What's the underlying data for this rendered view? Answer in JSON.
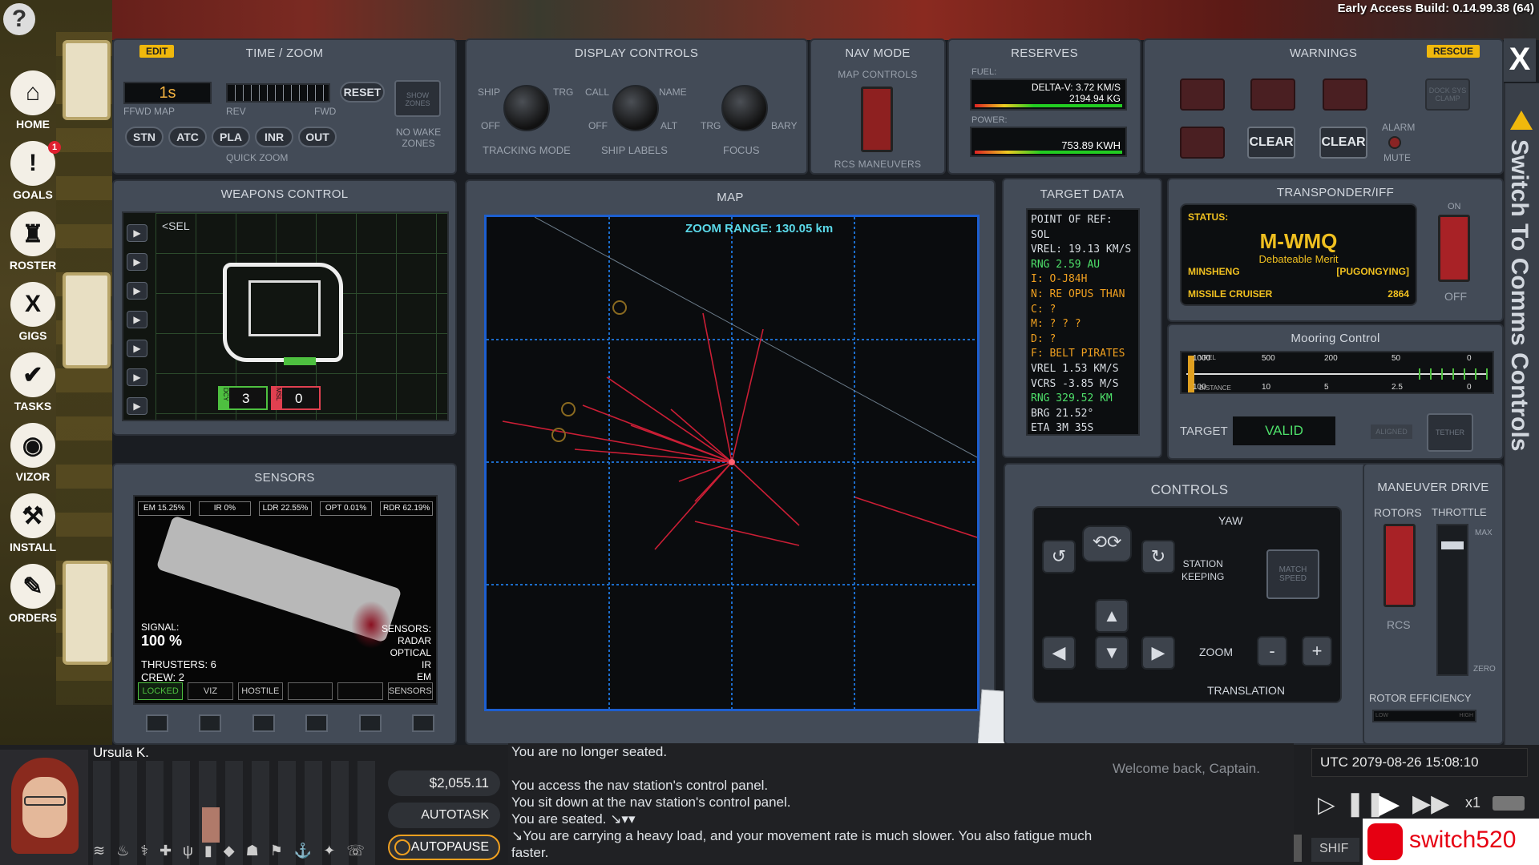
{
  "top": {
    "build": "Early Access Build: 0.14.99.38 (64)"
  },
  "sidebar": {
    "help": "?",
    "items": [
      {
        "label": "HOME",
        "icon": "home-icon",
        "glyph": "⌂"
      },
      {
        "label": "GOALS",
        "icon": "goals-icon",
        "glyph": "!",
        "badge": "1"
      },
      {
        "label": "ROSTER",
        "icon": "roster-icon",
        "glyph": "♜"
      },
      {
        "label": "GIGS",
        "icon": "gigs-icon",
        "glyph": "X"
      },
      {
        "label": "TASKS",
        "icon": "tasks-icon",
        "glyph": "✔"
      },
      {
        "label": "VIZOR",
        "icon": "vizor-icon",
        "glyph": "◉"
      },
      {
        "label": "INSTALL",
        "icon": "hammer-icon",
        "glyph": "⚒"
      },
      {
        "label": "ORDERS",
        "icon": "orders-icon",
        "glyph": "✎"
      }
    ]
  },
  "timezoom": {
    "edit": "EDIT",
    "title": "TIME / ZOOM",
    "speed": "1s",
    "ffwd": "FFWD MAP",
    "rev": "REV",
    "fwd": "FWD",
    "reset": "RESET",
    "quick": [
      "STN",
      "ATC",
      "PLA",
      "INR",
      "OUT"
    ],
    "quick_label": "QUICK ZOOM",
    "show_zones": "SHOW ZONES",
    "no_wake": "NO WAKE ZONES"
  },
  "display": {
    "title": "DISPLAY CONTROLS",
    "tracking": {
      "l": "SHIP",
      "r": "TRG",
      "off": "OFF",
      "label": "TRACKING MODE"
    },
    "labels": {
      "l": "CALL",
      "r": "NAME",
      "off": "OFF",
      "alt": "ALT",
      "label": "SHIP LABELS"
    },
    "focus": {
      "l": "TRG",
      "r": "BARY",
      "label": "FOCUS"
    }
  },
  "nav": {
    "title": "NAV MODE",
    "sub": "MAP CONTROLS",
    "rcs": "RCS MANEUVERS"
  },
  "reserves": {
    "title": "RESERVES",
    "fuel": "FUEL:",
    "dv": "DELTA-V: 3.72 KM/S",
    "kg": "2194.94 KG",
    "power": "POWER:",
    "kwh": "753.89 KWH"
  },
  "warnings": {
    "title": "WARNINGS",
    "rescue": "RESCUE",
    "clear1": "CLEAR",
    "clear2": "CLEAR",
    "alarm": "ALARM",
    "mute": "MUTE",
    "dock": "DOCK SYS CLAMP"
  },
  "weapons": {
    "title": "WEAPONS CONTROL",
    "sel": "<SEL",
    "dcy_label": "DCY",
    "dcy": "3",
    "msl_label": "MSL",
    "msl": "0"
  },
  "sensors": {
    "title": "SENSORS",
    "readouts": [
      "EM 15.25%",
      "IR 0%",
      "LDR 22.55%",
      "OPT 0.01%",
      "RDR 62.19%"
    ],
    "signal_label": "SIGNAL:",
    "signal": "100 %",
    "thrusters": "THRUSTERS: 6",
    "crew": "CREW: 2",
    "types": [
      "SENSORS:",
      "RADAR",
      "OPTICAL",
      "IR",
      "EM"
    ],
    "tabs": [
      "LOCKED",
      "VIZ",
      "HOSTILE",
      "",
      "",
      "SENSORS"
    ]
  },
  "map": {
    "title": "MAP",
    "zoom": "ZOOM RANGE: 130.05 km"
  },
  "target": {
    "title": "TARGET DATA",
    "rows": [
      {
        "t": "POINT OF REF:",
        "c": "#d8dde3"
      },
      {
        "t": "SOL",
        "c": "#d8dde3"
      },
      {
        "t": "VREL: 19.13 KM/S",
        "c": "#d8dde3"
      },
      {
        "t": "RNG 2.59 AU",
        "c": "#4ee06a"
      },
      {
        "t": "I: O-J84H",
        "c": "#f0a020"
      },
      {
        "t": "N: RE OPUS THAN",
        "c": "#f0a020"
      },
      {
        "t": "C: ?",
        "c": "#f0a020"
      },
      {
        "t": "M: ? ? ?",
        "c": "#f0a020"
      },
      {
        "t": "D: ?",
        "c": "#f0a020"
      },
      {
        "t": "F: BELT PIRATES",
        "c": "#f0a020"
      },
      {
        "t": "VREL 1.53 KM/S",
        "c": "#d8dde3"
      },
      {
        "t": "VCRS -3.85 M/S",
        "c": "#d8dde3"
      },
      {
        "t": "RNG 329.52 KM",
        "c": "#4ee06a"
      },
      {
        "t": "BRG 21.52°",
        "c": "#d8dde3"
      },
      {
        "t": "ETA 3M 35S",
        "c": "#d8dde3"
      }
    ]
  },
  "transponder": {
    "title": "TRANSPONDER/IFF",
    "status": "STATUS:",
    "call": "M-WMQ",
    "merit": "Debateable Merit",
    "owner": "MINSHENG",
    "tag": "[PUGONGYING]",
    "class": "MISSILE CRUISER",
    "num": "2864",
    "on": "ON",
    "off": "OFF"
  },
  "mooring": {
    "title": "Mooring Control",
    "vrel": "VREL",
    "distance": "DISTANCE",
    "top_ticks": [
      "1000",
      "500",
      "200",
      "50",
      "0"
    ],
    "bot_ticks": [
      "100",
      "10",
      "5",
      "2.5",
      "0"
    ],
    "target": "TARGET",
    "valid": "VALID",
    "aligned": "ALIGNED",
    "tether": "TETHER"
  },
  "controls": {
    "title": "CONTROLS",
    "yaw": "YAW",
    "station": "STATION",
    "keeping": "KEEPING",
    "match": "MATCH SPEED",
    "zoom": "ZOOM",
    "minus": "-",
    "plus": "+",
    "translation": "TRANSLATION"
  },
  "maneuver": {
    "title": "MANEUVER DRIVE",
    "rotors": "ROTORS",
    "throttle": "THROTTLE",
    "max": "MAX",
    "zero": "ZERO",
    "rcs": "RCS",
    "eff": "ROTOR EFFICIENCY",
    "low": "LOW",
    "high": "HIGH"
  },
  "sidepanel": {
    "text": "Switch To Comms Controls",
    "close": "X"
  },
  "char": {
    "name": "Ursula K.",
    "money": "$2,055.11",
    "autotask": "AUTOTASK",
    "autopause": "AUTOPAUSE"
  },
  "log": {
    "welcome": "Welcome back, Captain.",
    "lines": [
      "You are no longer seated.",
      "",
      "You access the nav station's control panel.",
      "You sit down at the nav station's control panel.",
      "You are seated. ↘▾▾",
      "↘You are carrying a heavy load, and your movement rate is much slower. You also fatigue much",
      "faster."
    ]
  },
  "clock": {
    "utc": "UTC 2079-08-26 15:08:10",
    "speed": "x1",
    "shift": "SHIF"
  },
  "watermark": "switch520"
}
